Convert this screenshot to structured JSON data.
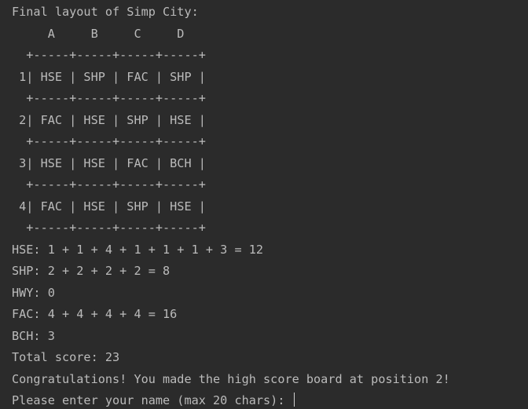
{
  "console": {
    "title_line": "Final layout of Simp City:",
    "column_header": "     A     B     C     D",
    "grid_border": "  +-----+-----+-----+-----+",
    "grid_rows": [
      " 1| HSE | SHP | FAC | SHP |",
      " 2| FAC | HSE | SHP | HSE |",
      " 3| HSE | HSE | FAC | BCH |",
      " 4| FAC | HSE | SHP | HSE |"
    ],
    "scores": [
      "HSE: 1 + 1 + 4 + 1 + 1 + 1 + 3 = 12",
      "SHP: 2 + 2 + 2 + 2 = 8",
      "HWY: 0",
      "FAC: 4 + 4 + 4 + 4 = 16",
      "BCH: 3"
    ],
    "total_score": "Total score: 23",
    "congrats": "Congratulations! You made the high score board at position 2!",
    "prompt": "Please enter your name (max 20 chars): ",
    "input_value": ""
  },
  "colors": {
    "background": "#2b2b2b",
    "text": "#bbbbbb"
  }
}
